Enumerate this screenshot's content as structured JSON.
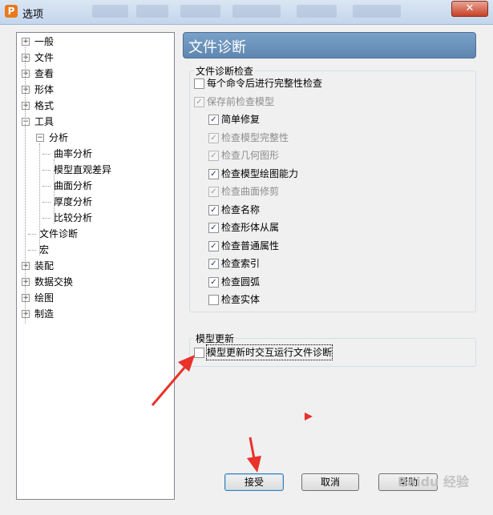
{
  "window": {
    "title": "选项",
    "app_icon_letter": "P",
    "close_glyph": "✕"
  },
  "tree": {
    "items": [
      {
        "label": "一般",
        "expander": "+"
      },
      {
        "label": "文件",
        "expander": "+"
      },
      {
        "label": "查看",
        "expander": "+"
      },
      {
        "label": "形体",
        "expander": "+"
      },
      {
        "label": "格式",
        "expander": "+"
      },
      {
        "label": "工具",
        "expander": "−"
      },
      {
        "label": "分析",
        "expander": "−"
      },
      {
        "label": "曲率分析"
      },
      {
        "label": "模型直观差异"
      },
      {
        "label": "曲面分析"
      },
      {
        "label": "厚度分析"
      },
      {
        "label": "比较分析"
      },
      {
        "label": "文件诊断"
      },
      {
        "label": "宏"
      },
      {
        "label": "装配",
        "expander": "+"
      },
      {
        "label": "数据交换",
        "expander": "+"
      },
      {
        "label": "绘图",
        "expander": "+"
      },
      {
        "label": "制造",
        "expander": "+"
      }
    ]
  },
  "panel": {
    "title": "文件诊断",
    "check_group": {
      "label": "文件诊断检查",
      "items": [
        {
          "label": "每个命令后进行完整性检查",
          "checked": false,
          "disabled": false
        },
        {
          "label": "保存前检查模型",
          "checked": true,
          "disabled": true
        },
        {
          "label": "简单修复",
          "checked": true,
          "disabled": false
        },
        {
          "label": "检查模型完整性",
          "checked": true,
          "disabled": true
        },
        {
          "label": "检查几何图形",
          "checked": true,
          "disabled": true
        },
        {
          "label": "检查模型绘图能力",
          "checked": true,
          "disabled": false
        },
        {
          "label": "检查曲面修剪",
          "checked": true,
          "disabled": true
        },
        {
          "label": "检查名称",
          "checked": true,
          "disabled": false
        },
        {
          "label": "检查形体从属",
          "checked": true,
          "disabled": false
        },
        {
          "label": "检查普通属性",
          "checked": true,
          "disabled": false
        },
        {
          "label": "检查索引",
          "checked": true,
          "disabled": false
        },
        {
          "label": "检查圆弧",
          "checked": true,
          "disabled": false
        },
        {
          "label": "检查实体",
          "checked": false,
          "disabled": false
        }
      ]
    },
    "update_group": {
      "label": "模型更新",
      "item": {
        "label": "模型更新时交互运行文件诊断",
        "checked": false
      }
    }
  },
  "buttons": {
    "accept": "接受",
    "cancel": "取消",
    "help": "帮助"
  },
  "check_glyph": "✓",
  "watermark": "Baidu 经验",
  "colors": {
    "annotation_arrow": "#e8322a",
    "header_bg": "#6f95bd",
    "title_bar": "#c9d9ee"
  }
}
